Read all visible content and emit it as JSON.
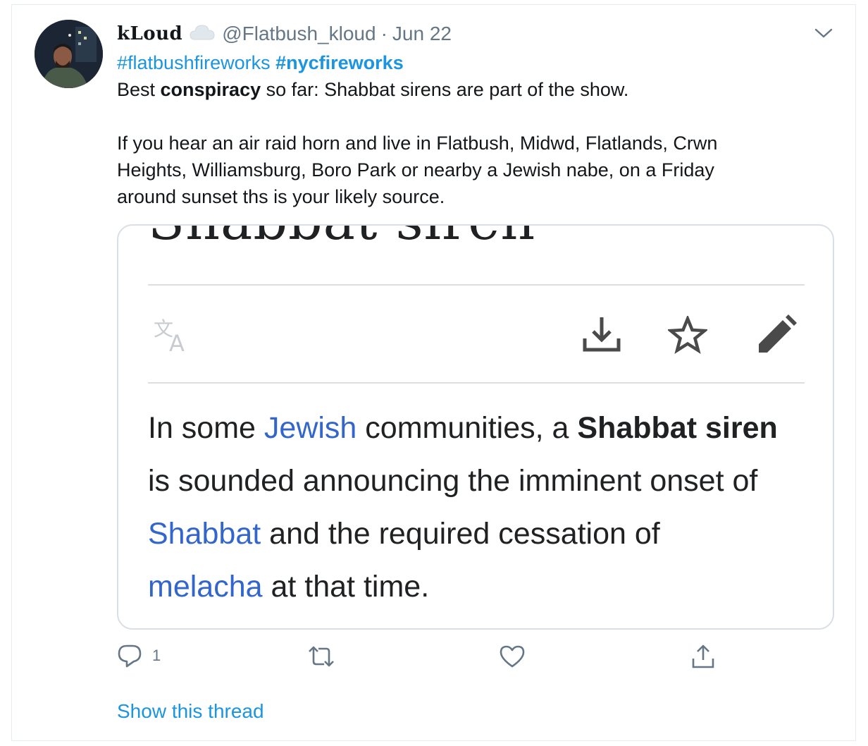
{
  "tweet": {
    "display_name": "kLoud",
    "handle": "@Flatbush_kloud",
    "separator": "·",
    "date": "Jun 22",
    "hashtags": [
      "#flatbushfireworks",
      "#nycfireworks"
    ],
    "line1_pre": "Best ",
    "line1_bold": "conspiracy",
    "line1_post": " so far: Shabbat sirens are part of the show.",
    "para_lines": [
      "If you hear an air raid horn and live in Flatbush, Midwd, Flatlands, Crwn",
      "Heights, Williamsburg, Boro Park or nearby a Jewish nabe, on a Friday",
      "around sunset ths is your likely source."
    ]
  },
  "card": {
    "title": "Shabbat siren",
    "icons": [
      "translate-icon",
      "download-icon",
      "star-icon",
      "pencil-icon"
    ],
    "line1_pre": "In some ",
    "line1_link": "Jewish",
    "line1_mid": " communities, a ",
    "line1_bold": "Shabbat siren",
    "line2": "is sounded announcing the imminent onset of",
    "line3_link": "Shabbat",
    "line3_post": " and the required cessation of",
    "line4_link": "melacha",
    "line4_post": " at that time."
  },
  "actions": {
    "reply_count": "1",
    "icons": [
      "reply-icon",
      "retweet-icon",
      "like-icon",
      "share-icon"
    ]
  },
  "show_thread": "Show this thread",
  "colors": {
    "link": "#1b95e0",
    "muted": "#657786",
    "wiki_link": "#3366cc"
  }
}
